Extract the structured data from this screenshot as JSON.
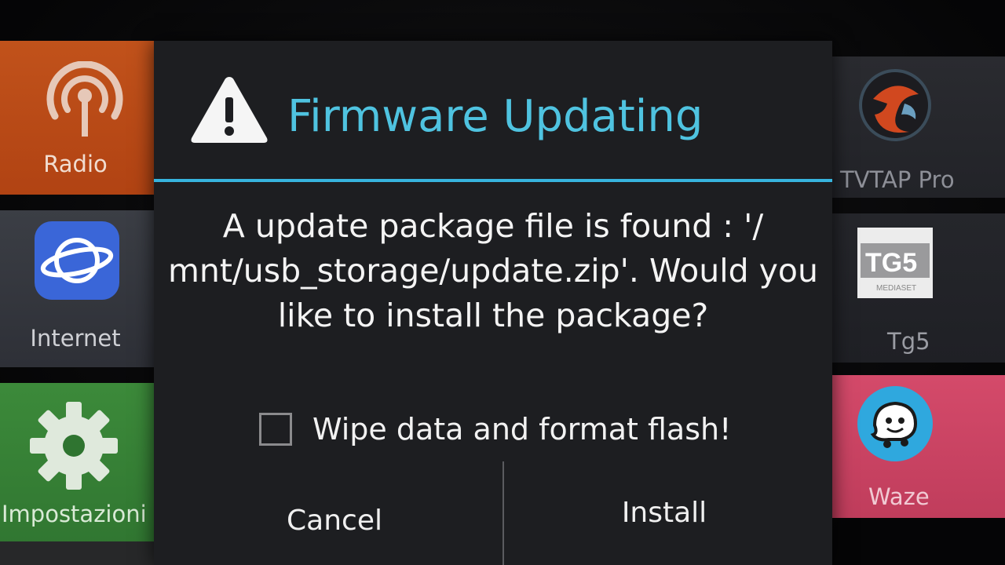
{
  "background_tiles": {
    "radio": {
      "label": "Radio",
      "icon": "radio-broadcast-icon",
      "color": "#c1521b"
    },
    "internet": {
      "label": "Internet",
      "icon": "globe-planet-icon",
      "color": "#3a66d8"
    },
    "settings": {
      "label": "Impostazioni",
      "icon": "gear-icon",
      "color": "#3c8a3a"
    },
    "tvtap": {
      "label": "TVTAP Pro",
      "icon": "tvtap-logo-icon"
    },
    "tg5": {
      "label": "Tg5",
      "icon": "tg5-logo-icon",
      "logo_text": "TG5",
      "logo_subtext": "MEDIASET"
    },
    "waze": {
      "label": "Waze",
      "icon": "waze-icon",
      "color": "#d44a6a"
    }
  },
  "dialog": {
    "icon": "warning-triangle-icon",
    "title": "Firmware Updating",
    "title_color": "#4fc3e0",
    "divider_color": "#37b4de",
    "message": "A update package file is found : '/ mnt/usb_storage/update.zip'. Would you like to install the package?",
    "wipe_checkbox": {
      "label": "Wipe data and format flash!",
      "checked": false
    },
    "buttons": {
      "cancel": "Cancel",
      "install": "Install"
    }
  }
}
